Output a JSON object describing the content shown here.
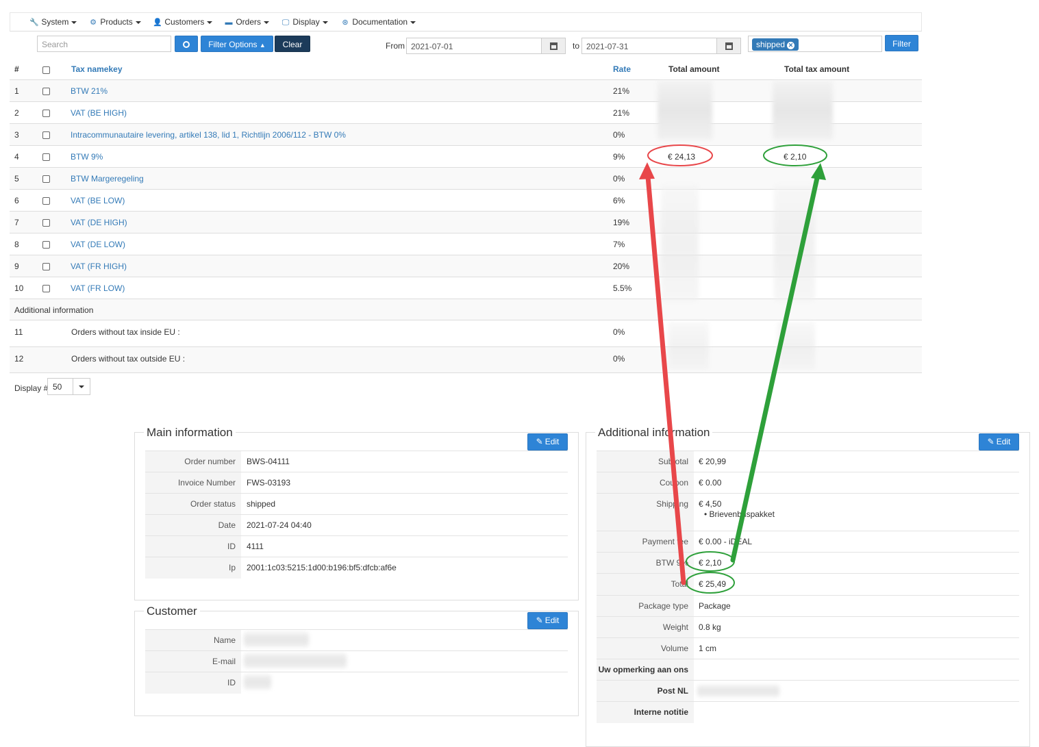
{
  "nav": {
    "items": [
      {
        "label": "System",
        "icon": "wrench-icon"
      },
      {
        "label": "Products",
        "icon": "cubes-icon"
      },
      {
        "label": "Customers",
        "icon": "user-icon"
      },
      {
        "label": "Orders",
        "icon": "credit-card-icon"
      },
      {
        "label": "Display",
        "icon": "monitor-icon"
      },
      {
        "label": "Documentation",
        "icon": "lifebuoy-icon"
      }
    ]
  },
  "filter": {
    "search_placeholder": "Search",
    "filter_options_label": "Filter Options",
    "clear_label": "Clear",
    "from_label": "From",
    "from_date": "2021-07-01",
    "to_label": "to",
    "to_date": "2021-07-31",
    "status_tag": "shipped",
    "filter_label": "Filter"
  },
  "table": {
    "headers": {
      "num": "#",
      "name": "Tax namekey",
      "rate": "Rate",
      "total": "Total amount",
      "tax": "Total tax amount"
    },
    "rows": [
      {
        "num": "1",
        "name": "BTW 21%",
        "rate": "21%"
      },
      {
        "num": "2",
        "name": "VAT (BE HIGH)",
        "rate": "21%"
      },
      {
        "num": "3",
        "name": "Intracommunautaire levering, artikel 138, lid 1, Richtlijn 2006/112 - BTW 0%",
        "rate": "0%"
      },
      {
        "num": "4",
        "name": "BTW 9%",
        "rate": "9%",
        "total": "€ 24,13",
        "tax": "€ 2,10"
      },
      {
        "num": "5",
        "name": "BTW Margeregeling",
        "rate": "0%"
      },
      {
        "num": "6",
        "name": "VAT (BE LOW)",
        "rate": "6%"
      },
      {
        "num": "7",
        "name": "VAT (DE HIGH)",
        "rate": "19%"
      },
      {
        "num": "8",
        "name": "VAT (DE LOW)",
        "rate": "7%"
      },
      {
        "num": "9",
        "name": "VAT (FR HIGH)",
        "rate": "20%"
      },
      {
        "num": "10",
        "name": "VAT (FR LOW)",
        "rate": "5.5%"
      }
    ],
    "additional_label": "Additional information",
    "extra_rows": [
      {
        "num": "11",
        "name": "Orders without tax inside EU :",
        "rate": "0%"
      },
      {
        "num": "12",
        "name": "Orders without tax outside EU :",
        "rate": "0%"
      }
    ],
    "display_label": "Display #",
    "display_value": "50"
  },
  "main_info": {
    "title": "Main information",
    "edit_label": "Edit",
    "fields": [
      {
        "key": "Order number",
        "value": "BWS-04111"
      },
      {
        "key": "Invoice Number",
        "value": "FWS-03193"
      },
      {
        "key": "Order status",
        "value": "shipped"
      },
      {
        "key": "Date",
        "value": "2021-07-24 04:40"
      },
      {
        "key": "ID",
        "value": "4111"
      },
      {
        "key": "Ip",
        "value": "2001:1c03:5215:1d00:b196:bf5:dfcb:af6e"
      }
    ]
  },
  "customer": {
    "title": "Customer",
    "edit_label": "Edit",
    "fields": [
      {
        "key": "Name"
      },
      {
        "key": "E-mail"
      },
      {
        "key": "ID"
      }
    ]
  },
  "additional": {
    "title": "Additional information",
    "edit_label": "Edit",
    "fields": [
      {
        "key": "Subtotal",
        "value": "€ 20,99"
      },
      {
        "key": "Coupon",
        "value": "€ 0.00"
      },
      {
        "key": "Shipping",
        "value": "€ 4,50",
        "sub": "Brievenbuspakket"
      },
      {
        "key": "Payment fee",
        "value": "€ 0.00 - iDEAL"
      },
      {
        "key": "BTW 9%",
        "value": "€ 2,10"
      },
      {
        "key": "Total",
        "value": "€ 25,49"
      },
      {
        "key": "Package type",
        "value": "Package"
      },
      {
        "key": "Weight",
        "value": "0.8 kg"
      },
      {
        "key": "Volume",
        "value": "1 cm"
      },
      {
        "key": "Uw opmerking aan ons",
        "value": ""
      },
      {
        "key": "Post NL",
        "value": ""
      },
      {
        "key": "Interne notitie",
        "value": ""
      }
    ]
  },
  "colors": {
    "link": "#337ab7",
    "primary": "#2e84d6",
    "dark_button": "#1c3b5a",
    "annotation_red": "#e8474a",
    "annotation_green": "#2ea03a"
  }
}
